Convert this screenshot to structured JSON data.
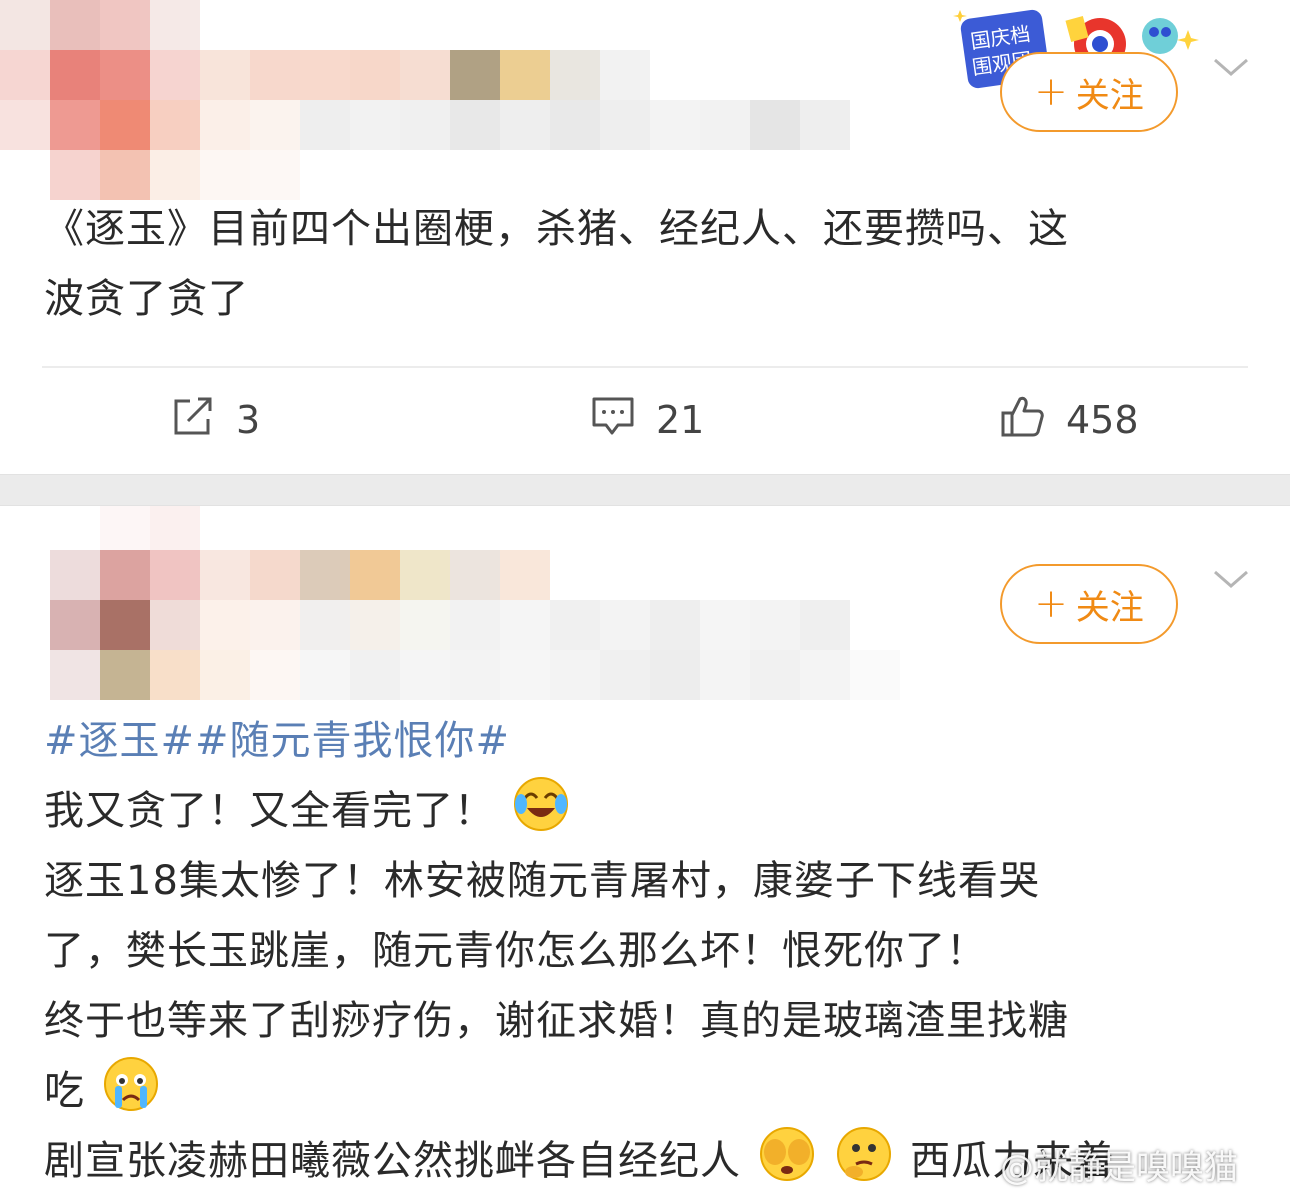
{
  "post1": {
    "follow_label": "关注",
    "text_line1": "《逐玉》目前四个出圈梗，杀猪、经纪人、还要攒吗、这",
    "text_line2": "波贪了贪了",
    "badge_text": "国庆档围观团",
    "actions": {
      "repost_count": "3",
      "comment_count": "21",
      "like_count": "458"
    },
    "mosaic_colors": [
      [
        "#f3e6e3",
        "#e9bfbb",
        "#f0c6c2",
        "#f5e9e7",
        "#ffffff",
        "#ffffff",
        "#ffffff",
        "#ffffff",
        "#ffffff",
        "#ffffff",
        "#ffffff",
        "#ffffff",
        "#ffffff",
        "#ffffff",
        "#ffffff",
        "#ffffff",
        "#ffffff"
      ],
      [
        "#f6d6d2",
        "#e8827a",
        "#ec8f86",
        "#f6d4d0",
        "#f8e4da",
        "#f7d8cc",
        "#f8d9cc",
        "#f7d7c9",
        "#f6ddd2",
        "#b0a184",
        "#ecce92",
        "#e9e6e0",
        "#f2f2f2",
        "#ffffff",
        "#ffffff",
        "#ffffff",
        "#ffffff"
      ],
      [
        "#f8e2df",
        "#ee9a92",
        "#ef8a74",
        "#f7cfc1",
        "#fbefe8",
        "#fbf3ee",
        "#eeeeee",
        "#f2f2f2",
        "#f0f0f0",
        "#e8e8e8",
        "#eeeeee",
        "#e9e9e9",
        "#eeeeee",
        "#f3f3f3",
        "#f2f2f2",
        "#e5e5e5",
        "#eeeeee"
      ],
      [
        "#ffffff",
        "#f6d3cf",
        "#f3c2b2",
        "#fbeee6",
        "#fdf7f3",
        "#fdf8f5",
        "#ffffff",
        "#ffffff",
        "#ffffff",
        "#ffffff",
        "#ffffff",
        "#ffffff",
        "#ffffff",
        "#ffffff",
        "#ffffff",
        "#ffffff",
        "#ffffff"
      ]
    ]
  },
  "post2": {
    "follow_label": "关注",
    "hashtag_line": "#逐玉##随元青我恨你#",
    "line1": "我又贪了！又全看完了！",
    "line2": "逐玉18集太惨了！林安被随元青屠村，康婆子下线看哭",
    "line3": "了，樊长玉跳崖，随元青你怎么那么坏！恨死你了！",
    "line4": "终于也等来了刮痧疗伤，谢征求婚！真的是玻璃渣里找糖",
    "line5": "吃",
    "line6": "剧宣张凌赫田曦薇公然挑衅各自经纪人",
    "line6_tail": "西瓜力来着",
    "mosaic_colors": [
      [
        "#ffffff",
        "#fdf6f6",
        "#fbf0ef",
        "#ffffff",
        "#ffffff",
        "#ffffff",
        "#ffffff",
        "#ffffff",
        "#ffffff",
        "#ffffff",
        "#ffffff",
        "#ffffff",
        "#ffffff",
        "#ffffff",
        "#ffffff",
        "#ffffff",
        "#ffffff"
      ],
      [
        "#eddcdc",
        "#dca3a0",
        "#f0c4c2",
        "#f8e7e0",
        "#f5d9cc",
        "#dccbb9",
        "#f1c996",
        "#efe6c9",
        "#ece4de",
        "#f9e7da",
        "#ffffff",
        "#ffffff",
        "#ffffff",
        "#ffffff",
        "#ffffff",
        "#ffffff",
        "#ffffff"
      ],
      [
        "#d8b2b2",
        "#a97166",
        "#efdcd8",
        "#fcf1ea",
        "#fbf2ed",
        "#f1efee",
        "#f5f0ea",
        "#f5f5f0",
        "#f2f2f2",
        "#f5f5f5",
        "#f0f0f0",
        "#f3f3f3",
        "#eeeeee",
        "#f5f5f5",
        "#f3f3f3",
        "#efefef",
        "#ffffff"
      ],
      [
        "#f0e4e4",
        "#c5b493",
        "#f8dfc9",
        "#fbf0e6",
        "#fdf7f3",
        "#f6f6f6",
        "#f1f1f1",
        "#f5f5f5",
        "#f3f3f3",
        "#f6f6f6",
        "#f3f3f3",
        "#f0f0f0",
        "#ededed",
        "#f4f4f4",
        "#f1f1f1",
        "#f4f4f4",
        "#fafafa"
      ]
    ]
  },
  "watermark": "@就静是嗅嗅猫",
  "colors": {
    "accent": "#f08a14",
    "hashtag": "#5a7fb5",
    "separator": "#ebebeb"
  }
}
